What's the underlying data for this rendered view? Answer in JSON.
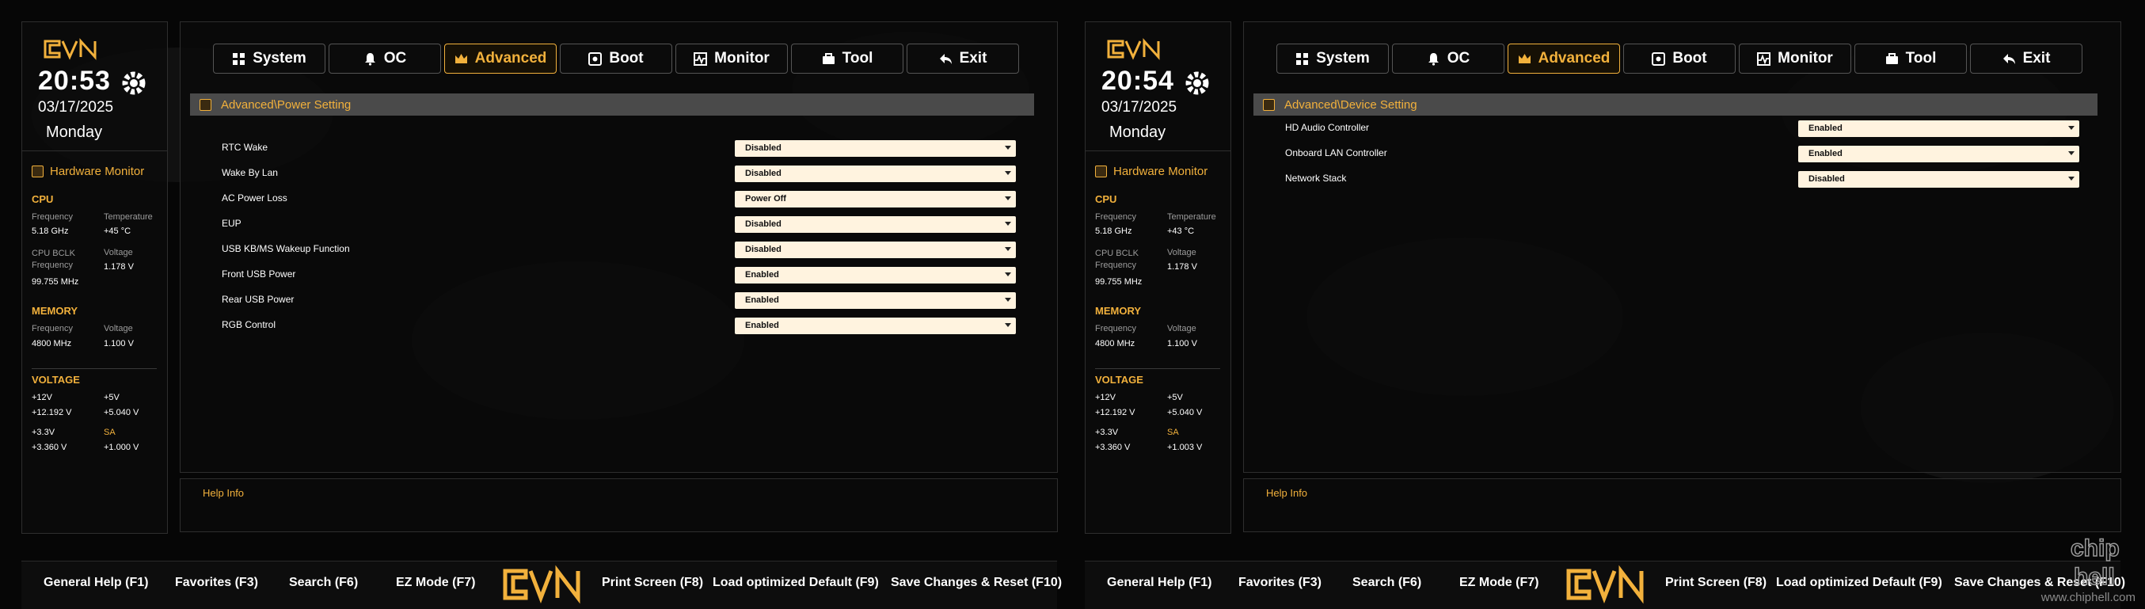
{
  "panes": [
    {
      "time": "20:53",
      "date": "03/17/2025",
      "weekday": "Monday",
      "hardware_monitor": {
        "title": "Hardware Monitor",
        "cpu": {
          "label": "CPU",
          "frequency_label": "Frequency",
          "frequency": "5.18 GHz",
          "temperature_label": "Temperature",
          "temperature": "+45 °C",
          "bclk_label": "CPU BCLK Frequency",
          "bclk": "99.755 MHz",
          "voltage_label": "Voltage",
          "voltage": "1.178 V"
        },
        "memory": {
          "label": "MEMORY",
          "frequency_label": "Frequency",
          "frequency": "4800 MHz",
          "voltage_label": "Voltage",
          "voltage": "1.100 V"
        },
        "voltage": {
          "label": "VOLTAGE",
          "v12_label": "+12V",
          "v12": "+12.192 V",
          "v5_label": "+5V",
          "v5": "+5.040 V",
          "v33_label": "+3.3V",
          "v33": "+3.360 V",
          "sa_label": "SA",
          "sa": "+1.000 V"
        }
      },
      "section_title": "Advanced\\Power Setting",
      "settings": [
        {
          "label": "RTC Wake",
          "value": "Disabled"
        },
        {
          "label": "Wake By Lan",
          "value": "Disabled"
        },
        {
          "label": "AC Power Loss",
          "value": "Power Off"
        },
        {
          "label": "EUP",
          "value": "Disabled"
        },
        {
          "label": "USB KB/MS Wakeup Function",
          "value": "Disabled"
        },
        {
          "label": "Front USB Power",
          "value": "Enabled"
        },
        {
          "label": "Rear USB Power",
          "value": "Enabled"
        },
        {
          "label": "RGB Control",
          "value": "Enabled"
        }
      ]
    },
    {
      "time": "20:54",
      "date": "03/17/2025",
      "weekday": "Monday",
      "hardware_monitor": {
        "title": "Hardware Monitor",
        "cpu": {
          "label": "CPU",
          "frequency_label": "Frequency",
          "frequency": "5.18 GHz",
          "temperature_label": "Temperature",
          "temperature": "+43 °C",
          "bclk_label": "CPU BCLK Frequency",
          "bclk": "99.755 MHz",
          "voltage_label": "Voltage",
          "voltage": "1.178 V"
        },
        "memory": {
          "label": "MEMORY",
          "frequency_label": "Frequency",
          "frequency": "4800 MHz",
          "voltage_label": "Voltage",
          "voltage": "1.100 V"
        },
        "voltage": {
          "label": "VOLTAGE",
          "v12_label": "+12V",
          "v12": "+12.192 V",
          "v5_label": "+5V",
          "v5": "+5.040 V",
          "v33_label": "+3.3V",
          "v33": "+3.360 V",
          "sa_label": "SA",
          "sa": "+1.003 V"
        }
      },
      "section_title": "Advanced\\Device Setting",
      "settings": [
        {
          "label": "HD Audio Controller",
          "value": "Enabled"
        },
        {
          "label": "Onboard LAN Controller",
          "value": "Enabled"
        },
        {
          "label": "Network Stack",
          "value": "Disabled"
        }
      ]
    }
  ],
  "tabs": [
    {
      "label": "System",
      "icon": "grid-icon",
      "active": false
    },
    {
      "label": "OC",
      "icon": "bell-icon",
      "active": false
    },
    {
      "label": "Advanced",
      "icon": "crown-icon",
      "active": true
    },
    {
      "label": "Boot",
      "icon": "disk-icon",
      "active": false
    },
    {
      "label": "Monitor",
      "icon": "pulse-icon",
      "active": false
    },
    {
      "label": "Tool",
      "icon": "toolbox-icon",
      "active": false
    },
    {
      "label": "Exit",
      "icon": "back-arrow-icon",
      "active": false
    }
  ],
  "help_info_label": "Help Info",
  "footer": {
    "general_help": "General Help (F1)",
    "favorites": "Favorites (F3)",
    "search": "Search (F6)",
    "ez_mode": "EZ Mode (F7)",
    "print_screen": "Print Screen (F8)",
    "load_default": "Load optimized Default (F9)",
    "save_reset": "Save Changes & Reset (F10)"
  },
  "watermark": "www.chiphell.com",
  "colors": {
    "accent": "#f2b13c",
    "dropdown_bg": "#fff3df",
    "section_bar": "#4a4a4a",
    "background": "#060606"
  }
}
